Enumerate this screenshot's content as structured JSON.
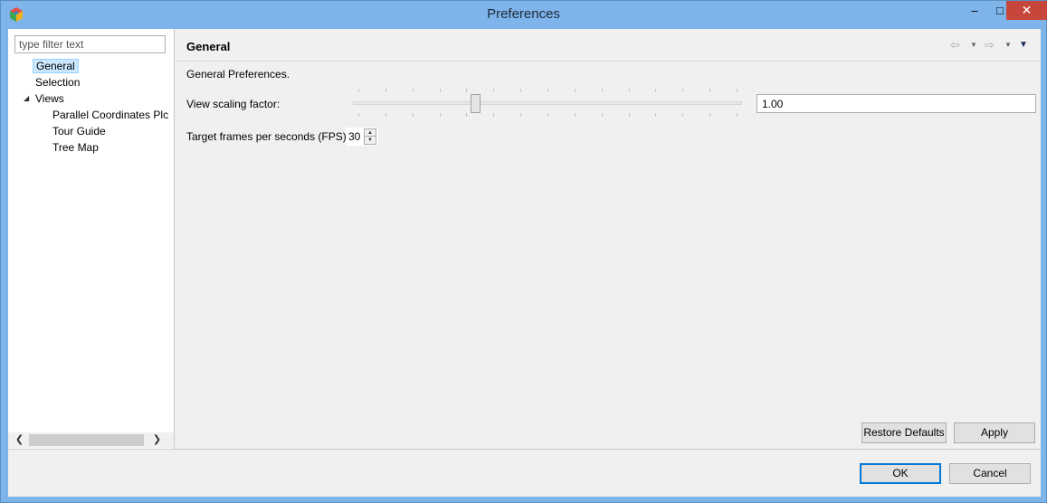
{
  "window": {
    "title": "Preferences",
    "minimize": "–",
    "maximize": "□",
    "close": "✕"
  },
  "sidebar": {
    "filter_placeholder": "type filter text",
    "items": [
      {
        "label": "General",
        "selected": true
      },
      {
        "label": "Selection"
      },
      {
        "label": "Views",
        "expanded": true
      },
      {
        "label": "Parallel Coordinates Plc"
      },
      {
        "label": "Tour Guide"
      },
      {
        "label": "Tree Map"
      }
    ],
    "scroll_left": "❮",
    "scroll_right": "❯",
    "expander": "◢"
  },
  "page": {
    "title": "General",
    "description": "General Preferences.",
    "nav": {
      "back": "⇦",
      "forward": "⇨",
      "dropdown": "▼",
      "menu": "▼"
    },
    "scaling": {
      "label": "View scaling factor:",
      "value": "1.00",
      "slider_fraction": 0.31
    },
    "fps": {
      "label": "Target frames per seconds (FPS)",
      "value": "30",
      "up": "▲",
      "down": "▼"
    },
    "restore_defaults": "Restore Defaults",
    "apply": "Apply"
  },
  "footer": {
    "ok": "OK",
    "cancel": "Cancel"
  }
}
